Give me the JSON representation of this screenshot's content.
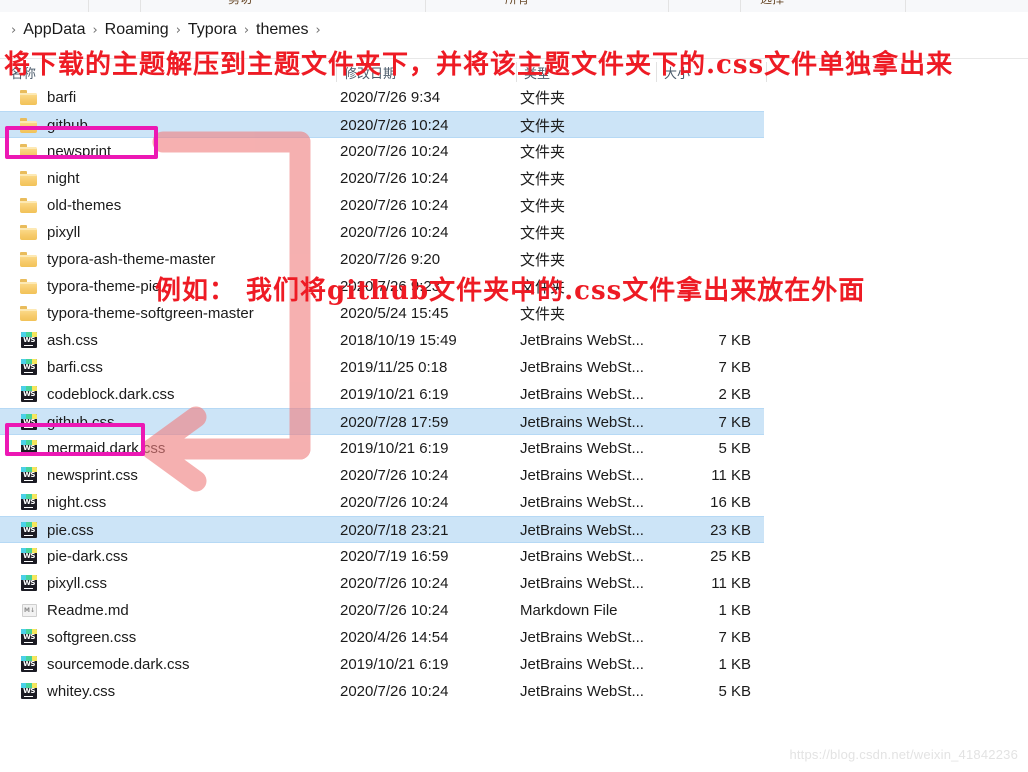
{
  "ribbon": {
    "clipped_labels": [
      "剪切",
      "所有",
      "选择"
    ]
  },
  "breadcrumb": {
    "separator": "›",
    "crumbs": [
      "AppData",
      "Roaming",
      "Typora",
      "themes"
    ]
  },
  "columns": {
    "name": "名称",
    "date": "修改日期",
    "type": "类型",
    "size": "大小"
  },
  "rows": [
    {
      "icon": "folder-icon",
      "name": "barfi",
      "date": "2020/7/26 9:34",
      "type": "文件夹",
      "size": "",
      "selected": false
    },
    {
      "icon": "folder-icon",
      "name": "github",
      "date": "2020/7/26 10:24",
      "type": "文件夹",
      "size": "",
      "selected": true
    },
    {
      "icon": "folder-icon",
      "name": "newsprint",
      "date": "2020/7/26 10:24",
      "type": "文件夹",
      "size": "",
      "selected": false
    },
    {
      "icon": "folder-icon",
      "name": "night",
      "date": "2020/7/26 10:24",
      "type": "文件夹",
      "size": "",
      "selected": false
    },
    {
      "icon": "folder-icon",
      "name": "old-themes",
      "date": "2020/7/26 10:24",
      "type": "文件夹",
      "size": "",
      "selected": false
    },
    {
      "icon": "folder-icon",
      "name": "pixyll",
      "date": "2020/7/26 10:24",
      "type": "文件夹",
      "size": "",
      "selected": false
    },
    {
      "icon": "folder-icon",
      "name": "typora-ash-theme-master",
      "date": "2020/7/26 9:20",
      "type": "文件夹",
      "size": "",
      "selected": false
    },
    {
      "icon": "folder-icon",
      "name": "typora-theme-pie",
      "date": "2020/7/26 9:23",
      "type": "文件夹",
      "size": "",
      "selected": false
    },
    {
      "icon": "folder-icon",
      "name": "typora-theme-softgreen-master",
      "date": "2020/5/24 15:45",
      "type": "文件夹",
      "size": "",
      "selected": false
    },
    {
      "icon": "webstorm-css-icon",
      "name": "ash.css",
      "date": "2018/10/19 15:49",
      "type": "JetBrains WebSt...",
      "size": "7 KB",
      "selected": false
    },
    {
      "icon": "webstorm-css-icon",
      "name": "barfi.css",
      "date": "2019/11/25 0:18",
      "type": "JetBrains WebSt...",
      "size": "7 KB",
      "selected": false
    },
    {
      "icon": "webstorm-css-icon",
      "name": "codeblock.dark.css",
      "date": "2019/10/21 6:19",
      "type": "JetBrains WebSt...",
      "size": "2 KB",
      "selected": false
    },
    {
      "icon": "webstorm-css-icon",
      "name": "github.css",
      "date": "2020/7/28 17:59",
      "type": "JetBrains WebSt...",
      "size": "7 KB",
      "selected": true
    },
    {
      "icon": "webstorm-css-icon",
      "name": "mermaid.dark.css",
      "date": "2019/10/21 6:19",
      "type": "JetBrains WebSt...",
      "size": "5 KB",
      "selected": false
    },
    {
      "icon": "webstorm-css-icon",
      "name": "newsprint.css",
      "date": "2020/7/26 10:24",
      "type": "JetBrains WebSt...",
      "size": "11 KB",
      "selected": false
    },
    {
      "icon": "webstorm-css-icon",
      "name": "night.css",
      "date": "2020/7/26 10:24",
      "type": "JetBrains WebSt...",
      "size": "16 KB",
      "selected": false
    },
    {
      "icon": "webstorm-css-icon",
      "name": "pie.css",
      "date": "2020/7/18 23:21",
      "type": "JetBrains WebSt...",
      "size": "23 KB",
      "selected": true
    },
    {
      "icon": "webstorm-css-icon",
      "name": "pie-dark.css",
      "date": "2020/7/19 16:59",
      "type": "JetBrains WebSt...",
      "size": "25 KB",
      "selected": false
    },
    {
      "icon": "webstorm-css-icon",
      "name": "pixyll.css",
      "date": "2020/7/26 10:24",
      "type": "JetBrains WebSt...",
      "size": "11 KB",
      "selected": false
    },
    {
      "icon": "markdown-icon",
      "name": "Readme.md",
      "date": "2020/7/26 10:24",
      "type": "Markdown File",
      "size": "1 KB",
      "selected": false
    },
    {
      "icon": "webstorm-css-icon",
      "name": "softgreen.css",
      "date": "2020/4/26 14:54",
      "type": "JetBrains WebSt...",
      "size": "7 KB",
      "selected": false
    },
    {
      "icon": "webstorm-css-icon",
      "name": "sourcemode.dark.css",
      "date": "2019/10/21 6:19",
      "type": "JetBrains WebSt...",
      "size": "1 KB",
      "selected": false
    },
    {
      "icon": "webstorm-css-icon",
      "name": "whitey.css",
      "date": "2020/7/26 10:24",
      "type": "JetBrains WebSt...",
      "size": "5 KB",
      "selected": false
    }
  ],
  "annotations": {
    "top_text": "将下载的主题解压到主题文件夹下，并将该主题文件夹下的.css文件单独拿出来",
    "mid_text": "例如： 我们将github文件夹中的.css文件拿出来放在外面",
    "highlight_color": "#ec18b4",
    "arrow_color": "#f08080",
    "text_color": "#ee1b24",
    "highlighted_items": [
      "github",
      "github.css"
    ]
  },
  "watermark": {
    "text": "https://blog.csdn.net/weixin_41842236"
  },
  "icons": {
    "webstorm_label": "WS",
    "markdown_label": "M↓"
  }
}
